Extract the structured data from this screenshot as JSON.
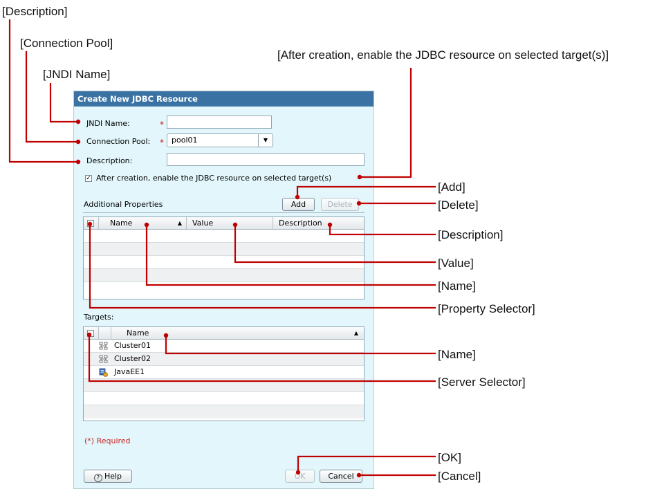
{
  "callouts": {
    "description": "[Description]",
    "connection_pool": "[Connection Pool]",
    "jndi_name": "[JNDI Name]",
    "after_creation": "[After creation, enable the JDBC resource on selected target(s)]",
    "add": "[Add]",
    "delete": "[Delete]",
    "column_description": "[Description]",
    "value": "[Value]",
    "name": "[Name]",
    "property_selector": "[Property Selector]",
    "target_name": "[Name]",
    "server_selector": "[Server Selector]",
    "ok": "[OK]",
    "cancel": "[Cancel]"
  },
  "dialog": {
    "title": "Create New JDBC Resource",
    "form": {
      "jndi_label": "JNDI Name:",
      "jndi_value": "",
      "pool_label": "Connection Pool:",
      "pool_value": "pool01",
      "description_label": "Description:",
      "description_value": "",
      "required_mark": "*",
      "enable_label": "After creation, enable the JDBC resource on selected target(s)",
      "enable_checked": true
    },
    "properties": {
      "heading": "Additional Properties",
      "add_label": "Add",
      "delete_label": "Delete",
      "columns": [
        "Name",
        "Value",
        "Description"
      ],
      "sort_indicator": "▲",
      "rows": []
    },
    "targets": {
      "heading": "Targets:",
      "column": "Name",
      "sort_indicator": "▲",
      "rows": [
        {
          "name": "Cluster01",
          "icon": "cluster-icon"
        },
        {
          "name": "Cluster02",
          "icon": "cluster-icon"
        },
        {
          "name": "JavaEE1",
          "icon": "server-icon"
        }
      ]
    },
    "required_note": "(*) Required",
    "help_label": "Help",
    "ok_label": "OK",
    "cancel_label": "Cancel"
  },
  "colors": {
    "title_bar": "#3a73a3",
    "dialog_bg": "#e2f6fb",
    "leader": "#c00000",
    "required": "#cc2222"
  }
}
